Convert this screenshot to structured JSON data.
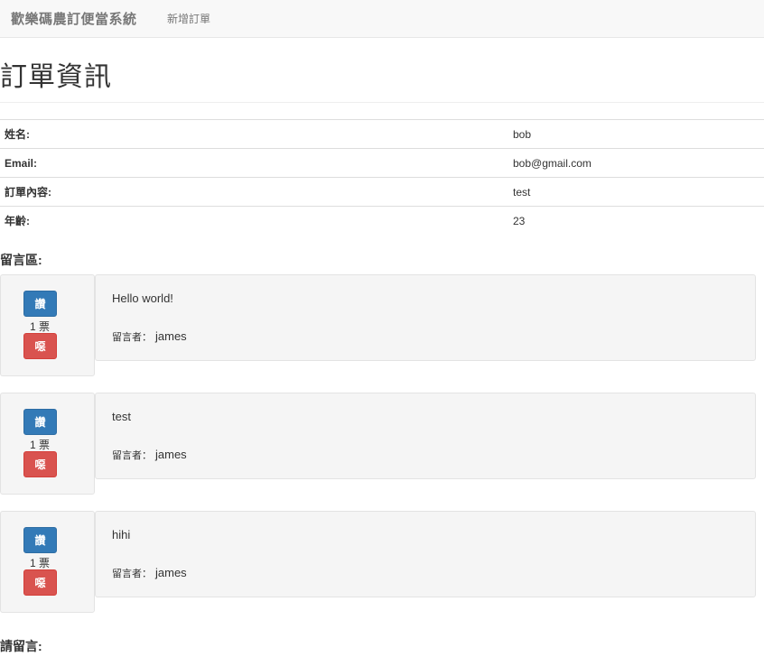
{
  "navbar": {
    "brand": "歡樂碼農訂便當系統",
    "new_order": "新增訂單"
  },
  "page_title": "訂單資訊",
  "order_info": [
    {
      "label": "姓名:",
      "value": "bob"
    },
    {
      "label": "Email:",
      "value": "bob@gmail.com"
    },
    {
      "label": "訂單內容:",
      "value": "test"
    },
    {
      "label": "年齡:",
      "value": "23"
    }
  ],
  "comments_heading": "留言區:",
  "comments": [
    {
      "upvote": "讚",
      "votes": "1 票",
      "downvote": "噁",
      "text": "Hello world!",
      "author_label": "留言者：",
      "author": "james"
    },
    {
      "upvote": "讚",
      "votes": "1 票",
      "downvote": "噁",
      "text": "test",
      "author_label": "留言者：",
      "author": "james"
    },
    {
      "upvote": "讚",
      "votes": "1 票",
      "downvote": "噁",
      "text": "hihi",
      "author_label": "留言者：",
      "author": "james"
    }
  ],
  "leave_comment_heading": "請留言:"
}
